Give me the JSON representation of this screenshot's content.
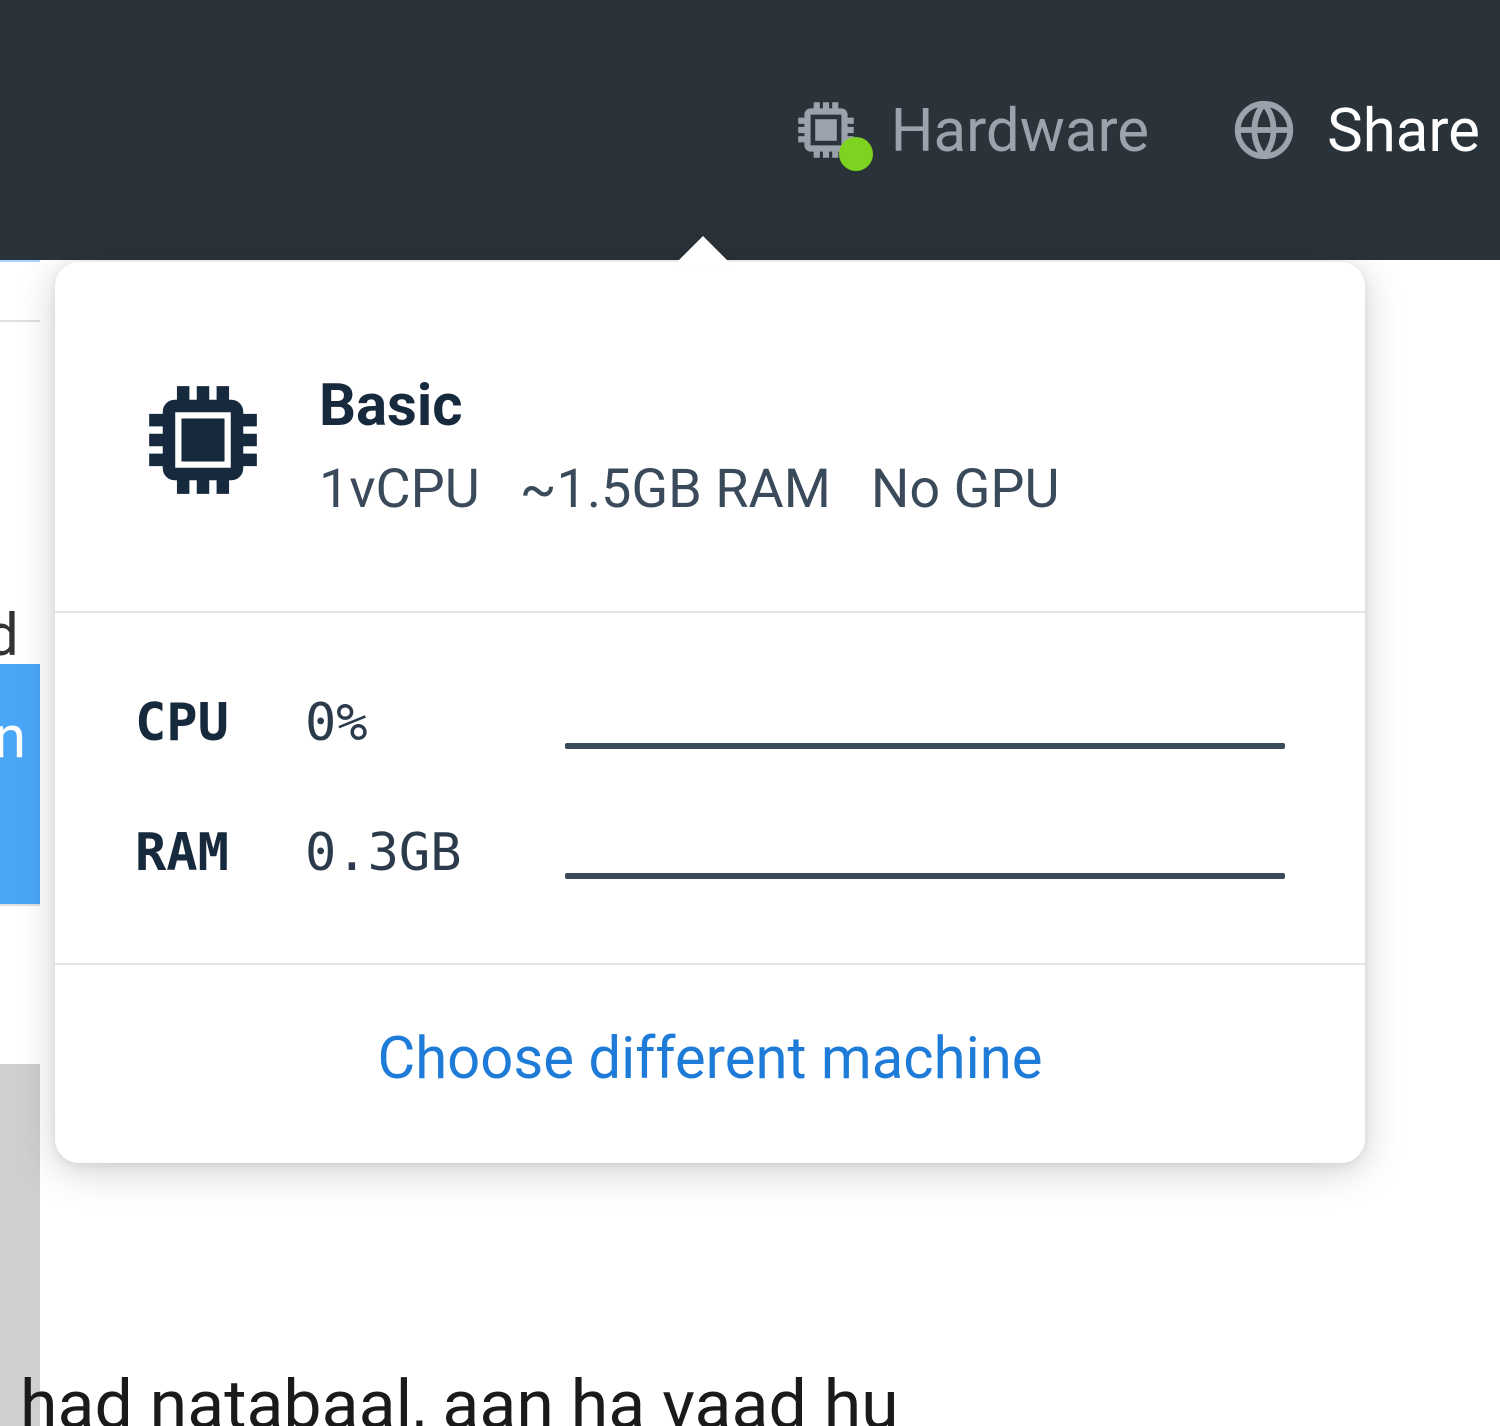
{
  "topbar": {
    "hardware_label": "Hardware",
    "share_label": "Share"
  },
  "popover": {
    "tier_name": "Basic",
    "spec_cpu": "1vCPU",
    "spec_ram": "~1.5GB RAM",
    "spec_gpu": "No GPU",
    "metrics": {
      "cpu_label": "CPU",
      "cpu_value": "0%",
      "ram_label": "RAM",
      "ram_value": "0.3GB"
    },
    "choose_label": "Choose different machine"
  },
  "background": {
    "truncated_d": "d",
    "truncated_n": "n",
    "bottom_fragment": "had natabaal, aan ha vaad hu"
  }
}
